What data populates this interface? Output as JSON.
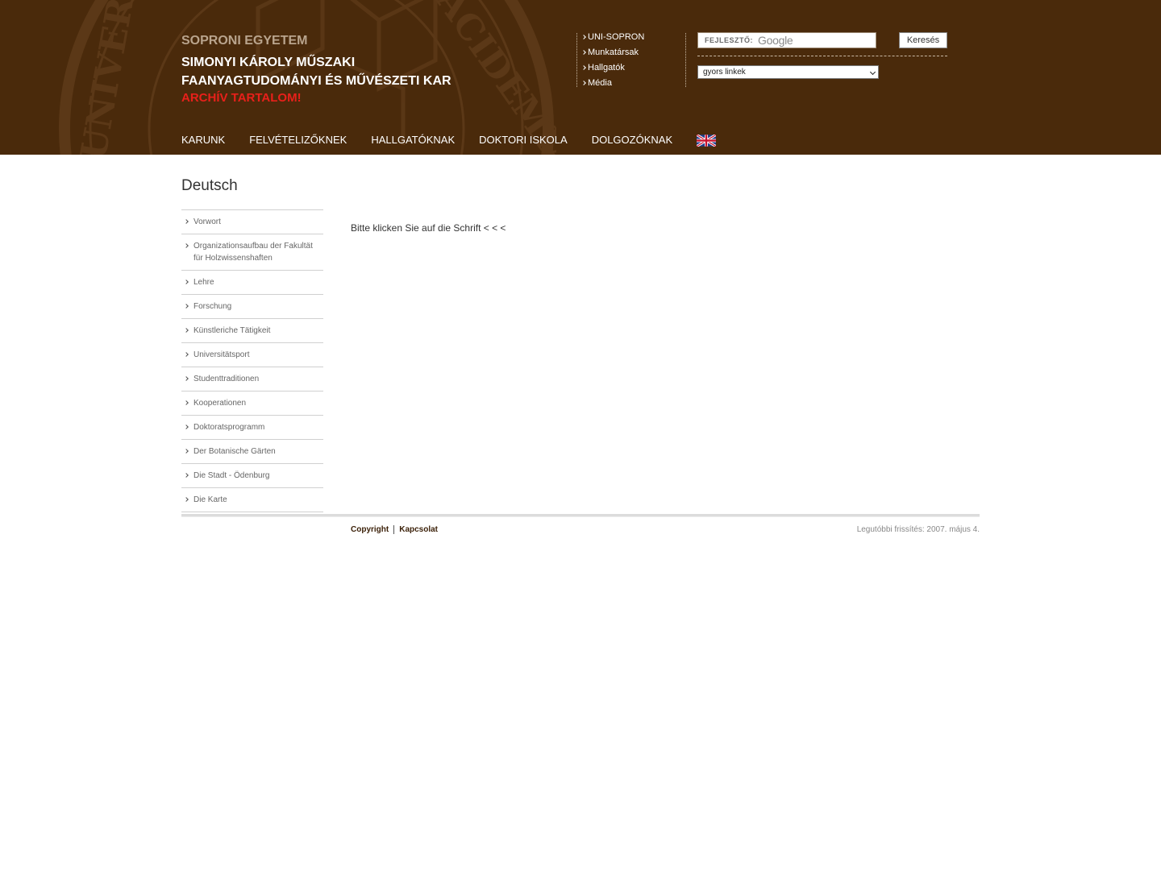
{
  "header": {
    "university": "SOPRONI EGYETEM",
    "faculty_line1": "SIMONYI KÁROLY MŰSZAKI",
    "faculty_line2": "FAANYAGTUDOMÁNYI ÉS MŰVÉSZETI KAR",
    "archive_notice": "ARCHÍV TARTALOM!",
    "quick_links": [
      "UNI-SOPRON",
      "Munkatársak",
      "Hallgatók",
      "Média"
    ],
    "search": {
      "provider_label": "FEJLESZTŐ:",
      "provider_logo": "Google",
      "button_label": "Keresés"
    },
    "quick_select": {
      "selected": "gyors linkek"
    },
    "nav": [
      "KARUNK",
      "FELVÉTELIZŐKNEK",
      "HALLGATÓKNAK",
      "DOKTORI ISKOLA",
      "DOLGOZÓKNAK"
    ],
    "language_flag_icon": "uk-flag-icon"
  },
  "page": {
    "title": "Deutsch",
    "sidebar": [
      "Vorwort",
      "Organizationsaufbau der Fakultät für Holzwissenshaften",
      "Lehre",
      "Forschung",
      "Künstleriche Tätigkeit",
      "Universitätsport",
      "Studenttraditionen",
      "Kooperationen",
      "Doktoratsprogramm",
      "Der Botanische Gärten",
      "Die Stadt - Ödenburg",
      "Die Karte"
    ],
    "body_text": "Bitte klicken Sie auf die Schrift < < <"
  },
  "footer": {
    "links": [
      "Copyright",
      "Kapcsolat"
    ],
    "last_update": "Legutóbbi frissítés: 2007. május 4."
  },
  "colors": {
    "header_bg": "#4a2a0b",
    "archive_red": "#e8201a",
    "university_tan": "#b9a48d",
    "footer_link": "#3a1f07"
  }
}
